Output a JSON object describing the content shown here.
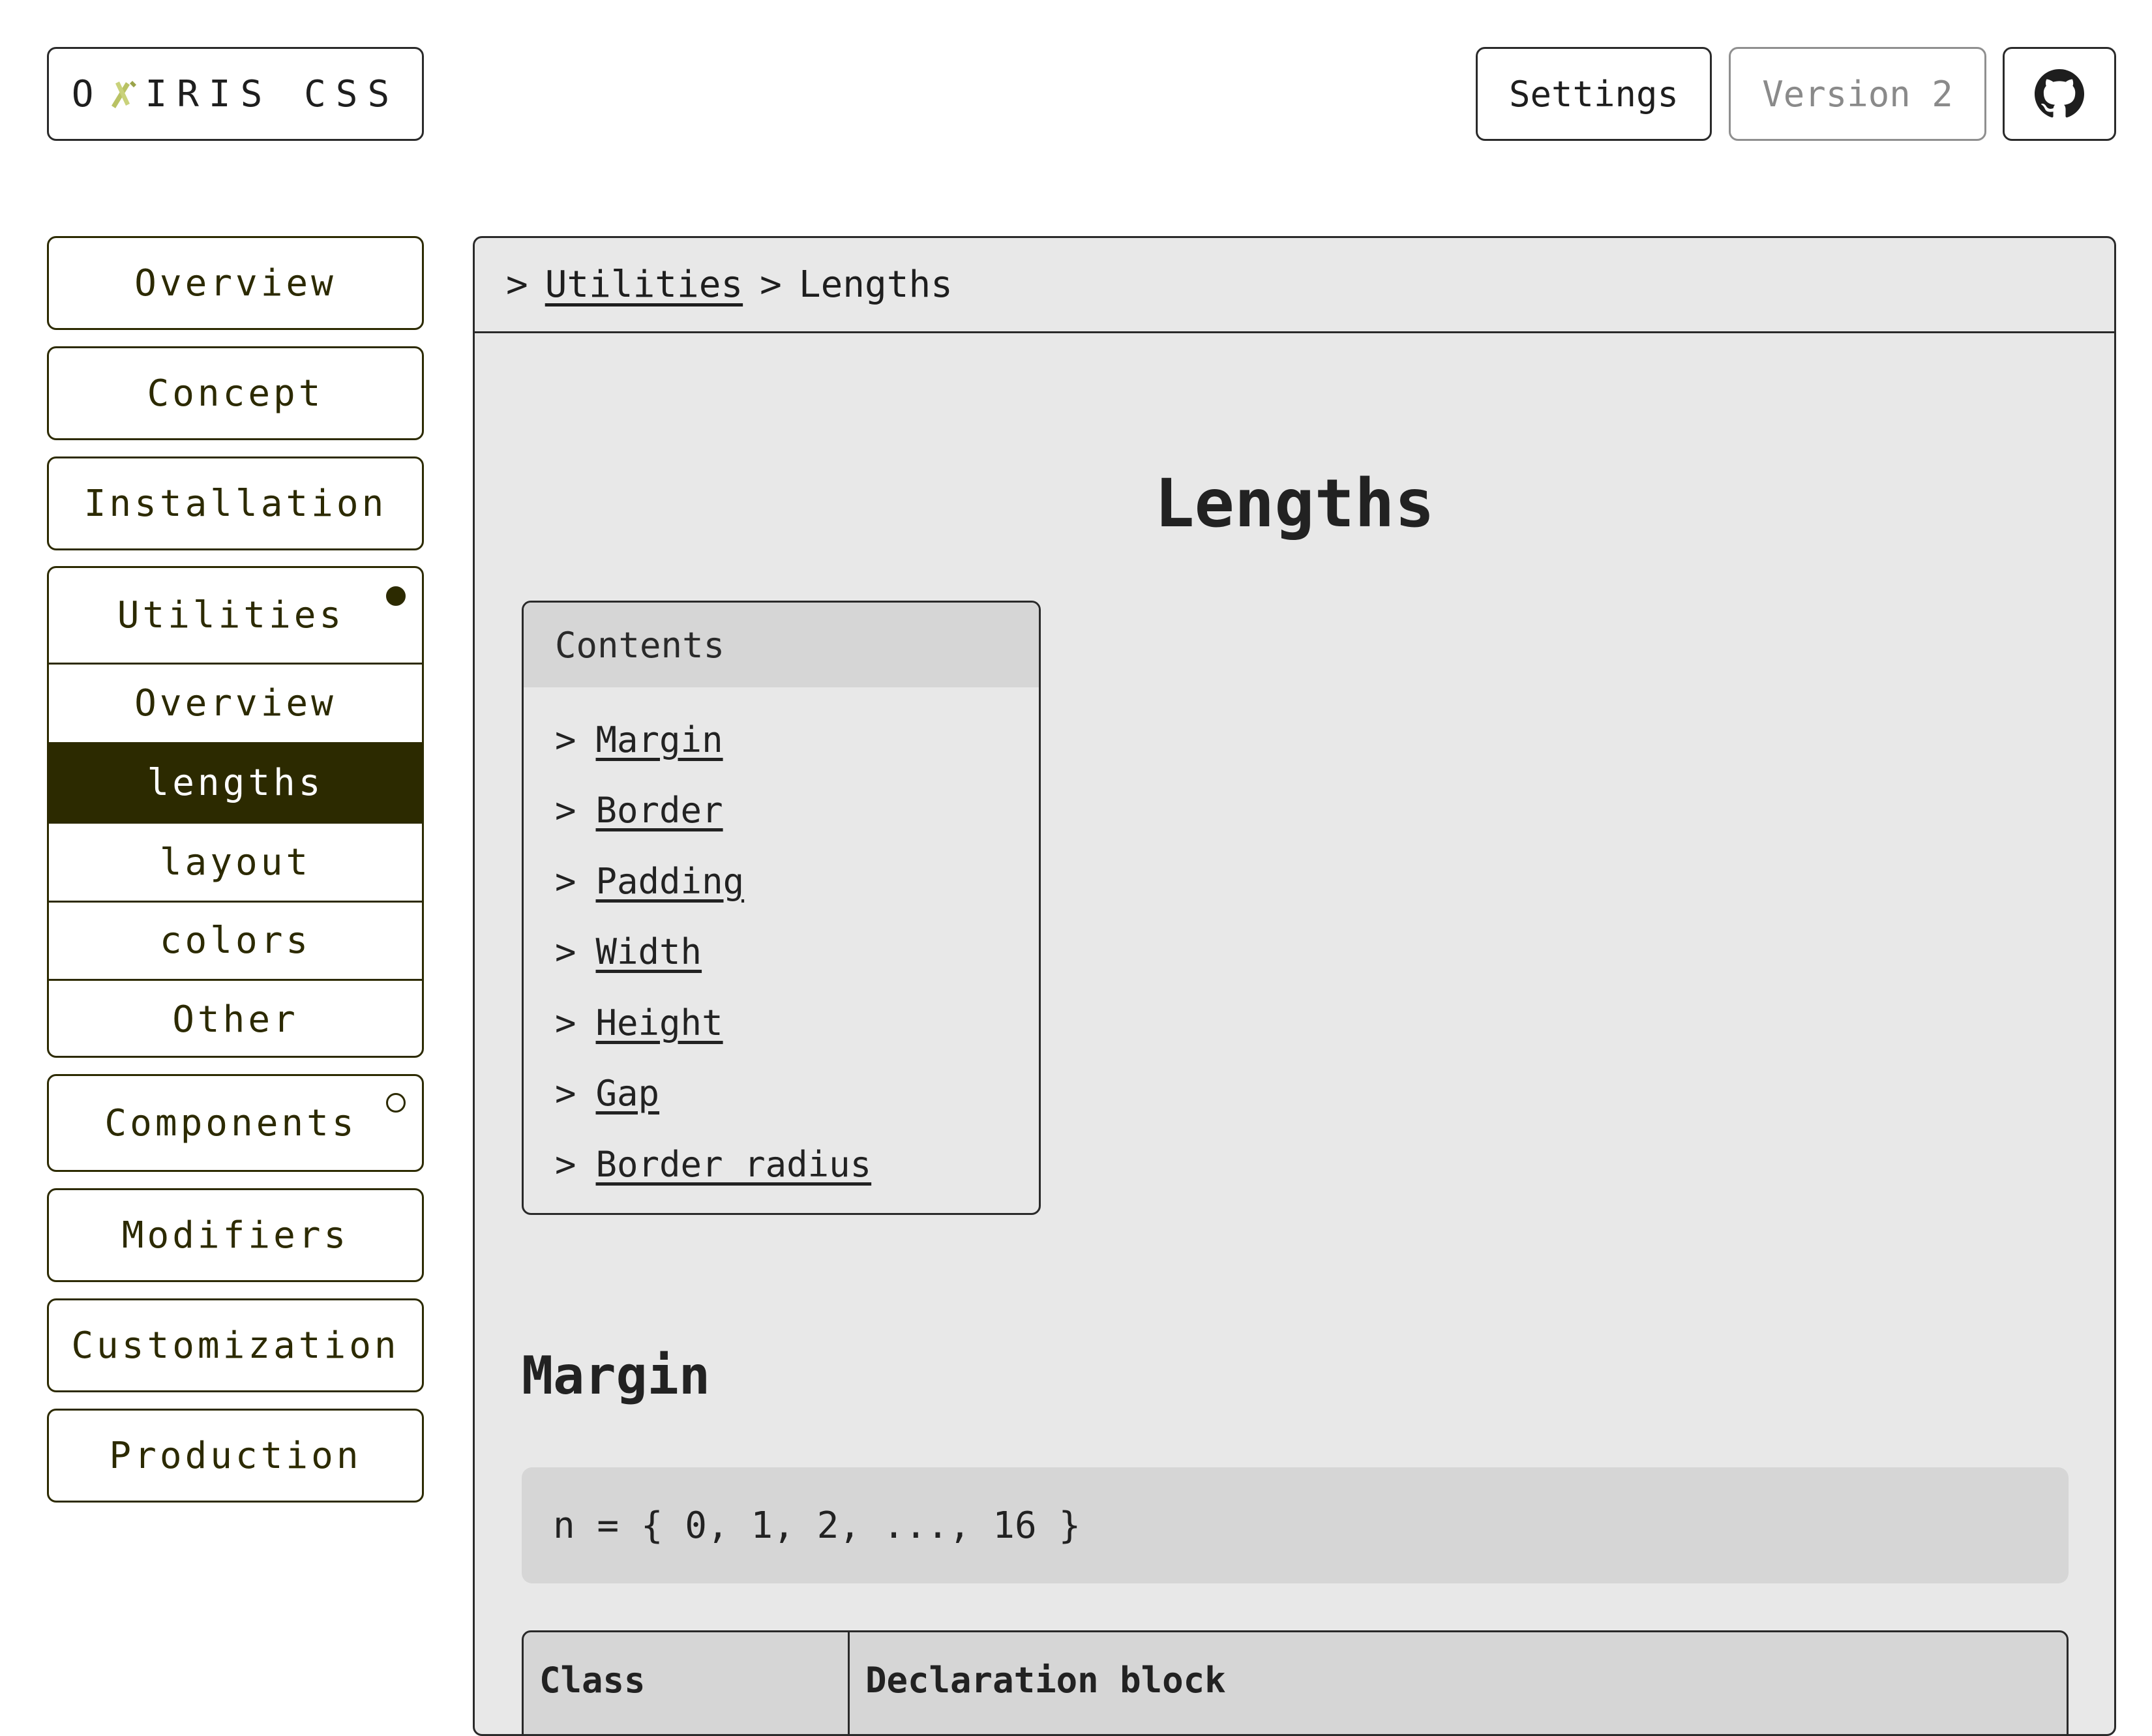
{
  "header": {
    "logo_left": "O",
    "logo_right": "IRIS CSS",
    "settings_label": "Settings",
    "version_label": "Version 2",
    "github_icon": "github-icon"
  },
  "sidebar": {
    "items_top": [
      {
        "label": "Overview"
      },
      {
        "label": "Concept"
      },
      {
        "label": "Installation"
      }
    ],
    "utilities": {
      "label": "Utilities",
      "status": "expanded",
      "sub_items": [
        {
          "label": "Overview"
        },
        {
          "label": "lengths",
          "active": true
        },
        {
          "label": "layout"
        },
        {
          "label": "colors"
        },
        {
          "label": "Other"
        }
      ]
    },
    "components": {
      "label": "Components",
      "status": "collapsed"
    },
    "items_bottom": [
      {
        "label": "Modifiers"
      },
      {
        "label": "Customization"
      },
      {
        "label": "Production"
      }
    ]
  },
  "breadcrumb": {
    "sep": ">",
    "parent": "Utilities",
    "current": "Lengths"
  },
  "main": {
    "title": "Lengths",
    "toc": {
      "heading": "Contents",
      "arrow": ">",
      "items": [
        "Margin",
        "Border",
        "Padding",
        "Width",
        "Height",
        "Gap",
        "Border radius"
      ]
    },
    "section": {
      "title": "Margin",
      "code": "n = { 0, 1, 2, ..., 16 }"
    },
    "table": {
      "headers": [
        "Class",
        "Declaration block"
      ]
    }
  },
  "colors": {
    "accent_dark": "#2c2a00",
    "panel_bg": "#e8e8e8",
    "code_bg": "#d6d6d6",
    "logo_mark": "#b9c264"
  }
}
